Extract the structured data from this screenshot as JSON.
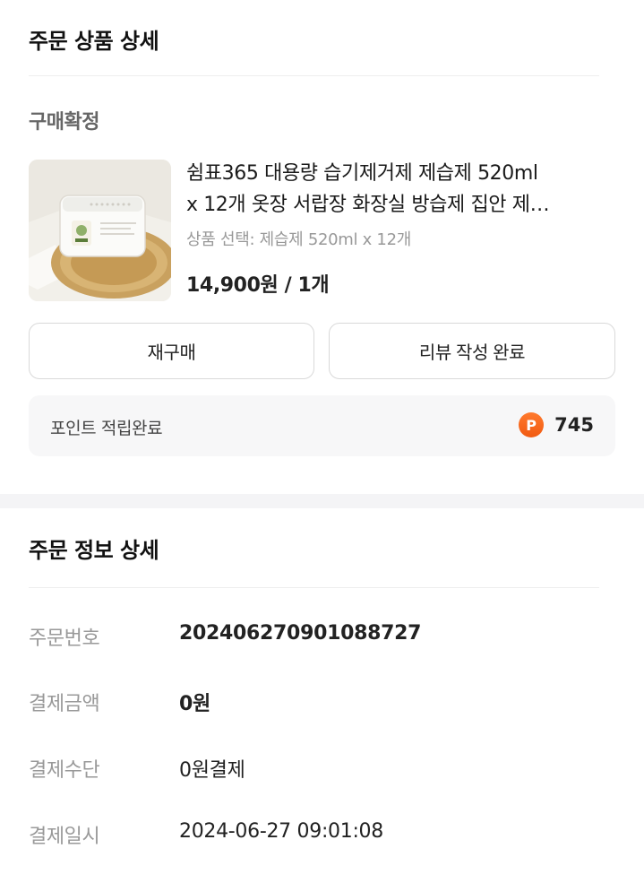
{
  "product_section": {
    "title": "주문 상품 상세",
    "status": "구매확정",
    "product": {
      "name_line1": "쉼표365 대용량 습기제거제 제습제 520ml",
      "name_line2": "x 12개 옷장 서랍장 화장실 방습제 집안 제…",
      "option": "상품 선택: 제습제 520ml x 12개",
      "price": "14,900원 / 1개"
    },
    "buttons": {
      "rebuy": "재구매",
      "review": "리뷰 작성 완료"
    },
    "points": {
      "label": "포인트 적립완료",
      "icon_letter": "P",
      "value": "745"
    }
  },
  "order_section": {
    "title": "주문 정보 상세",
    "rows": [
      {
        "label": "주문번호",
        "value": "20240627090108872​7"
      },
      {
        "label": "결제금액",
        "value": "0원"
      },
      {
        "label": "결제수단",
        "value": "0원결제"
      },
      {
        "label": "결제일시",
        "value": "2024-06-27 09:01:08"
      }
    ]
  },
  "colors": {
    "points_icon": "#f15a12",
    "band": "#f4f4f6"
  }
}
